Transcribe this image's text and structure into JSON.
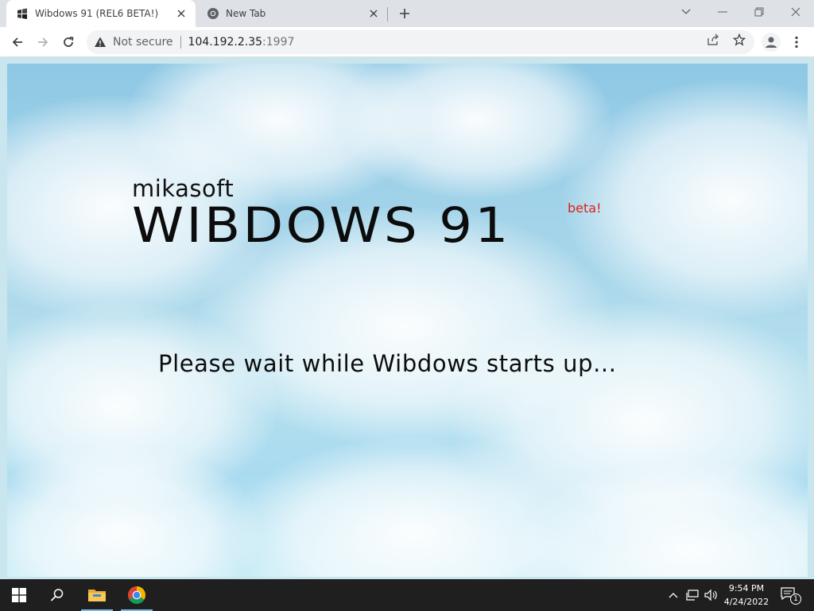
{
  "browser": {
    "tabs": [
      {
        "title": "Wibdows 91 (REL6 BETA!)",
        "active": true
      },
      {
        "title": "New Tab",
        "active": false
      }
    ],
    "omnibox": {
      "security_label": "Not secure",
      "host": "104.192.2.35",
      "port": ":1997"
    }
  },
  "page": {
    "maker": "mikasoft",
    "product": "WIBDOWS 91",
    "beta_tag": "beta!",
    "status_message": "Please wait while Wibdows starts up..."
  },
  "taskbar": {
    "time": "9:54 PM",
    "date": "4/24/2022",
    "notification_count": "1"
  },
  "colors": {
    "beta_red": "#e0201a",
    "sky_blue": "#9fd2ea",
    "taskbar": "#1f1f1f",
    "tab_bg": "#dee1e6"
  }
}
